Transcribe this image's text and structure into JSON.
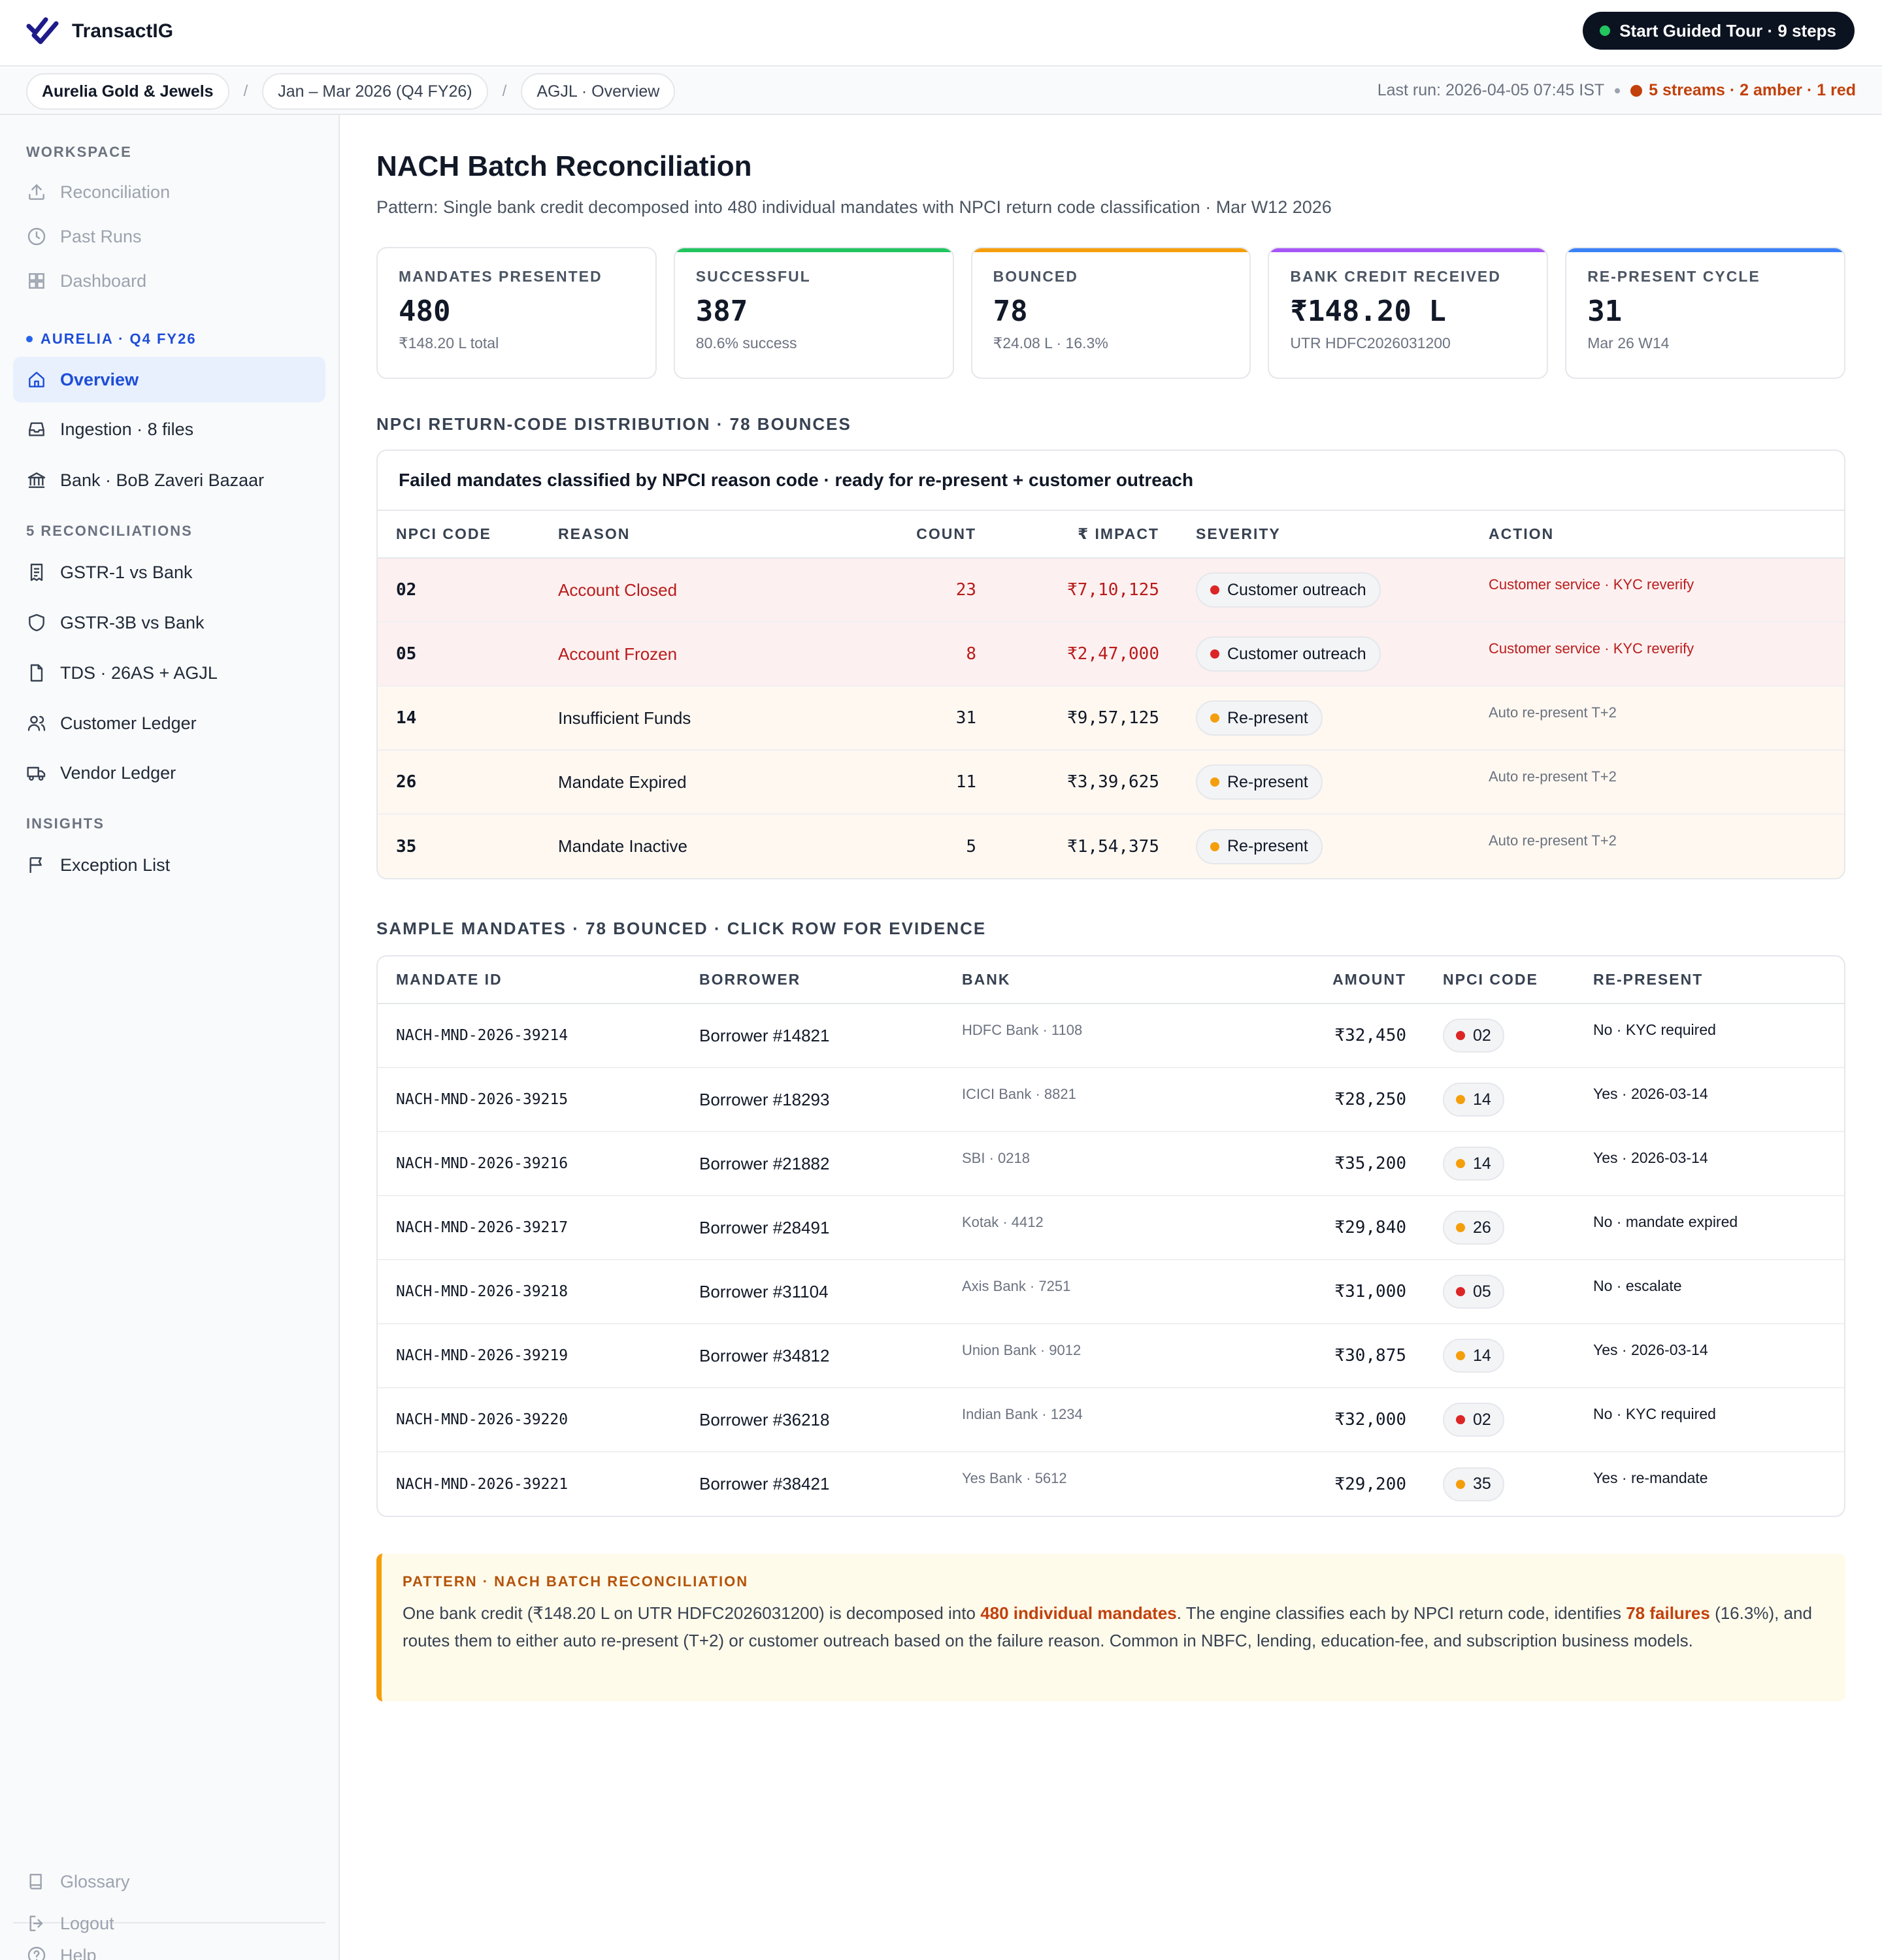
{
  "app": {
    "name": "TransactIG",
    "tour_label": "Start Guided Tour · 9 steps"
  },
  "breadcrumb": {
    "client": "Aurelia Gold & Jewels",
    "period": "Jan – Mar 2026 (Q4 FY26)",
    "view": "AGJL · Overview",
    "separator": "/"
  },
  "run": {
    "last_run": "Last run: 2026-04-05 07:45 IST",
    "streams": "5 streams · 2 amber · 1 red"
  },
  "sidebar": {
    "workspace_label": "WORKSPACE",
    "workspace_items": [
      "Reconciliation",
      "Past Runs",
      "Dashboard"
    ],
    "client_label": "AURELIA · Q4 FY26",
    "client_items": [
      "Overview",
      "Ingestion · 8 files",
      "Bank · BoB Zaveri Bazaar"
    ],
    "recon_label": "5 RECONCILIATIONS",
    "recon_items": [
      "GSTR-1 vs Bank",
      "GSTR-3B vs Bank",
      "TDS · 26AS + AGJL",
      "Customer Ledger",
      "Vendor Ledger"
    ],
    "insights_label": "INSIGHTS",
    "insights_items": [
      "Exception List"
    ],
    "footer_items": [
      "Help",
      "Glossary",
      "Logout"
    ]
  },
  "page": {
    "title": "NACH Batch Reconciliation",
    "subtitle": "Pattern: Single bank credit decomposed into 480 individual mandates with NPCI return code classification · Mar W12 2026"
  },
  "kpis": [
    {
      "label": "MANDATES PRESENTED",
      "value": "480",
      "sub": "₹148.20 L total",
      "accent": ""
    },
    {
      "label": "SUCCESSFUL",
      "value": "387",
      "sub": "80.6% success",
      "accent": "#22c55e"
    },
    {
      "label": "BOUNCED",
      "value": "78",
      "sub": "₹24.08 L · 16.3%",
      "accent": "#f59e0b"
    },
    {
      "label": "BANK CREDIT RECEIVED",
      "value": "₹148.20 L",
      "sub": "UTR HDFC2026031200",
      "accent": "#a855f7"
    },
    {
      "label": "RE-PRESENT CYCLE",
      "value": "31",
      "sub": "Mar 26 W14",
      "accent": "#3b82f6"
    }
  ],
  "distribution": {
    "section_title": "NPCI RETURN-CODE DISTRIBUTION · 78 BOUNCES",
    "card_title": "Failed mandates classified by NPCI reason code · ready for re-present + customer outreach",
    "headers": [
      "NPCI CODE",
      "REASON",
      "COUNT",
      "₹ IMPACT",
      "SEVERITY",
      "ACTION"
    ],
    "rows": [
      {
        "code": "02",
        "reason": "Account Closed",
        "count": "23",
        "impact": "₹7,10,125",
        "severity": "Customer outreach",
        "action": "Customer service · KYC reverify",
        "level": "red"
      },
      {
        "code": "05",
        "reason": "Account Frozen",
        "count": "8",
        "impact": "₹2,47,000",
        "severity": "Customer outreach",
        "action": "Customer service · KYC reverify",
        "level": "red"
      },
      {
        "code": "14",
        "reason": "Insufficient Funds",
        "count": "31",
        "impact": "₹9,57,125",
        "severity": "Re-present",
        "action": "Auto re-present T+2",
        "level": "amber"
      },
      {
        "code": "26",
        "reason": "Mandate Expired",
        "count": "11",
        "impact": "₹3,39,625",
        "severity": "Re-present",
        "action": "Auto re-present T+2",
        "level": "amber"
      },
      {
        "code": "35",
        "reason": "Mandate Inactive",
        "count": "5",
        "impact": "₹1,54,375",
        "severity": "Re-present",
        "action": "Auto re-present T+2",
        "level": "amber"
      }
    ]
  },
  "samples": {
    "section_title": "SAMPLE MANDATES · 78 BOUNCED · CLICK ROW FOR EVIDENCE",
    "headers": [
      "MANDATE ID",
      "BORROWER",
      "BANK",
      "AMOUNT",
      "NPCI CODE",
      "RE-PRESENT"
    ],
    "rows": [
      {
        "id": "NACH-MND-2026-39214",
        "borrower": "Borrower #14821",
        "bank": "HDFC Bank · 1108",
        "amount": "₹32,450",
        "code": "02",
        "level": "red",
        "represent": "No · KYC required"
      },
      {
        "id": "NACH-MND-2026-39215",
        "borrower": "Borrower #18293",
        "bank": "ICICI Bank · 8821",
        "amount": "₹28,250",
        "code": "14",
        "level": "amber",
        "represent": "Yes · 2026-03-14"
      },
      {
        "id": "NACH-MND-2026-39216",
        "borrower": "Borrower #21882",
        "bank": "SBI · 0218",
        "amount": "₹35,200",
        "code": "14",
        "level": "amber",
        "represent": "Yes · 2026-03-14"
      },
      {
        "id": "NACH-MND-2026-39217",
        "borrower": "Borrower #28491",
        "bank": "Kotak · 4412",
        "amount": "₹29,840",
        "code": "26",
        "level": "amber",
        "represent": "No · mandate expired"
      },
      {
        "id": "NACH-MND-2026-39218",
        "borrower": "Borrower #31104",
        "bank": "Axis Bank · 7251",
        "amount": "₹31,000",
        "code": "05",
        "level": "red",
        "represent": "No · escalate"
      },
      {
        "id": "NACH-MND-2026-39219",
        "borrower": "Borrower #34812",
        "bank": "Union Bank · 9012",
        "amount": "₹30,875",
        "code": "14",
        "level": "amber",
        "represent": "Yes · 2026-03-14"
      },
      {
        "id": "NACH-MND-2026-39220",
        "borrower": "Borrower #36218",
        "bank": "Indian Bank · 1234",
        "amount": "₹32,000",
        "code": "02",
        "level": "red",
        "represent": "No · KYC required"
      },
      {
        "id": "NACH-MND-2026-39221",
        "borrower": "Borrower #38421",
        "bank": "Yes Bank · 5612",
        "amount": "₹29,200",
        "code": "35",
        "level": "amber",
        "represent": "Yes · re-mandate"
      }
    ]
  },
  "pattern": {
    "label": "PATTERN · NACH BATCH RECONCILIATION",
    "part1": "One bank credit (₹148.20 L on UTR HDFC2026031200) is decomposed into ",
    "highlight1": "480 individual mandates",
    "part2": ". The engine classifies each by NPCI return code, identifies ",
    "highlight2": "78 failures",
    "part3": " (16.3%), and routes them to either auto re-present (T+2) or customer outreach based on the failure reason. Common in NBFC, lending, education-fee, and subscription business models."
  }
}
